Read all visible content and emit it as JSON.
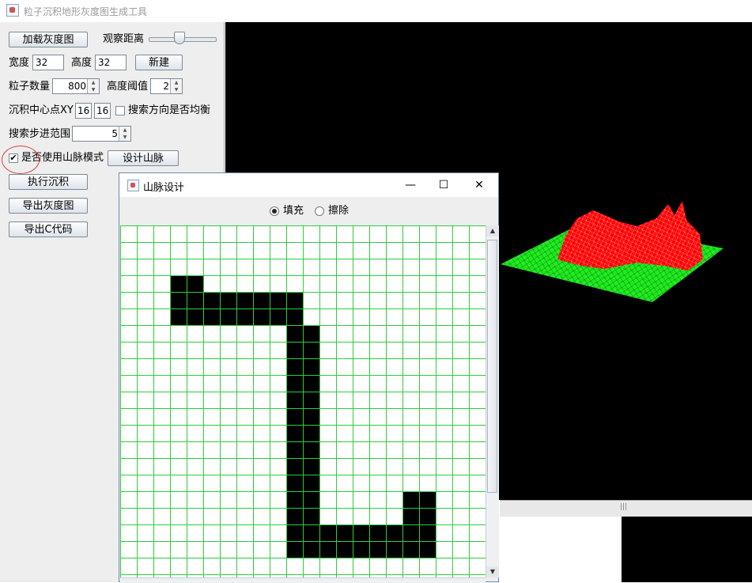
{
  "window": {
    "title": "粒子沉积地形灰度图生成工具"
  },
  "controls": {
    "load_button": "加载灰度图",
    "view_distance_label": "观察距离",
    "view_distance_level": 0.45,
    "width_label": "宽度",
    "width_value": "32",
    "height_label": "高度",
    "height_value": "32",
    "new_button": "新建",
    "particle_count_label": "粒子数量",
    "particle_count_value": "800",
    "height_threshold_label": "高度阈值",
    "height_threshold_value": "2",
    "center_label": "沉积中心点XY",
    "center_x": "16",
    "center_y": "16",
    "balance_label": "搜索方向是否均衡",
    "balance_checked": false,
    "step_range_label": "搜索步进范围",
    "step_range_value": "5",
    "mountain_mode_label": "是否使用山脉模式",
    "mountain_mode_checked": true,
    "design_mountain_button": "设计山脉",
    "execute_button": "执行沉积",
    "export_gray_button": "导出灰度图",
    "export_c_button": "导出C代码"
  },
  "dialog": {
    "title": "山脉设计",
    "radio_fill": "填充",
    "radio_erase": "擦除",
    "selected": "fill",
    "minimize_symbol": "—",
    "maximize_symbol": "☐",
    "close_symbol": "✕",
    "grid_cols": 22,
    "grid_rows": 21,
    "filled_cells": [
      [
        3,
        3
      ],
      [
        4,
        3
      ],
      [
        3,
        4
      ],
      [
        4,
        4
      ],
      [
        5,
        4
      ],
      [
        6,
        4
      ],
      [
        7,
        4
      ],
      [
        8,
        4
      ],
      [
        9,
        4
      ],
      [
        10,
        4
      ],
      [
        3,
        5
      ],
      [
        4,
        5
      ],
      [
        5,
        5
      ],
      [
        6,
        5
      ],
      [
        7,
        5
      ],
      [
        8,
        5
      ],
      [
        9,
        5
      ],
      [
        10,
        5
      ],
      [
        10,
        6
      ],
      [
        11,
        6
      ],
      [
        10,
        7
      ],
      [
        11,
        7
      ],
      [
        10,
        8
      ],
      [
        11,
        8
      ],
      [
        10,
        9
      ],
      [
        11,
        9
      ],
      [
        10,
        10
      ],
      [
        11,
        10
      ],
      [
        10,
        11
      ],
      [
        11,
        11
      ],
      [
        10,
        12
      ],
      [
        11,
        12
      ],
      [
        10,
        13
      ],
      [
        11,
        13
      ],
      [
        10,
        14
      ],
      [
        11,
        14
      ],
      [
        10,
        15
      ],
      [
        11,
        15
      ],
      [
        10,
        16
      ],
      [
        11,
        16
      ],
      [
        10,
        17
      ],
      [
        11,
        17
      ],
      [
        17,
        16
      ],
      [
        18,
        16
      ],
      [
        17,
        17
      ],
      [
        18,
        17
      ],
      [
        10,
        18
      ],
      [
        11,
        18
      ],
      [
        12,
        18
      ],
      [
        13,
        18
      ],
      [
        14,
        18
      ],
      [
        15,
        18
      ],
      [
        16,
        18
      ],
      [
        17,
        18
      ],
      [
        18,
        18
      ],
      [
        10,
        19
      ],
      [
        11,
        19
      ],
      [
        12,
        19
      ],
      [
        13,
        19
      ],
      [
        14,
        19
      ],
      [
        15,
        19
      ],
      [
        16,
        19
      ],
      [
        17,
        19
      ],
      [
        18,
        19
      ]
    ],
    "colors": {
      "grid_line": "#2ecc40",
      "fill": "#000000"
    }
  },
  "scene": {
    "terrain_color": "#22ee22",
    "mountain_color": "#ff0000",
    "background": "#000000"
  }
}
